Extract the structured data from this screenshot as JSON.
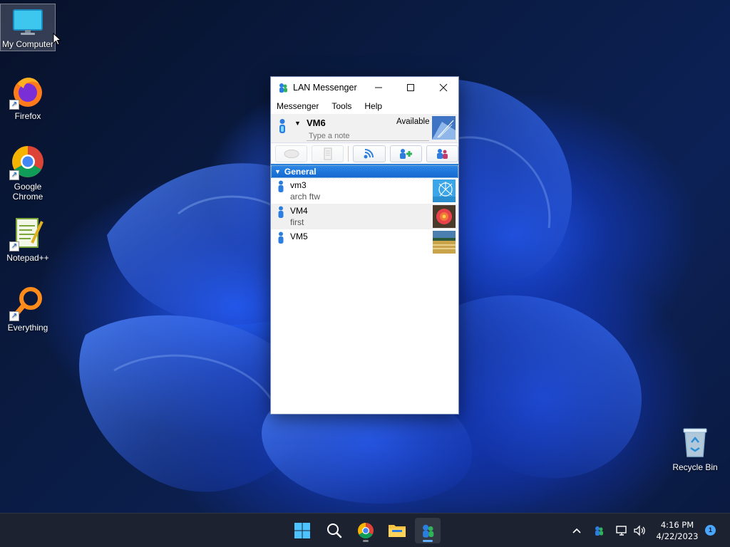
{
  "desktop": {
    "icons": [
      {
        "label": "My Computer",
        "icon": "monitor-icon"
      },
      {
        "label": "Firefox",
        "icon": "firefox-icon"
      },
      {
        "label": "Google Chrome",
        "icon": "chrome-icon"
      },
      {
        "label": "Notepad++",
        "icon": "notepadpp-icon"
      },
      {
        "label": "Everything",
        "icon": "magnifier-icon"
      },
      {
        "label": "Recycle Bin",
        "icon": "recycle-bin-icon"
      }
    ]
  },
  "window": {
    "title": "LAN Messenger",
    "menu": [
      "Messenger",
      "Tools",
      "Help"
    ],
    "user": {
      "name": "VM6",
      "status": "Available",
      "note_placeholder": "Type a note"
    },
    "group": "General",
    "contacts": [
      {
        "name": "vm3",
        "note": "arch ftw"
      },
      {
        "name": "VM4",
        "note": "first"
      },
      {
        "name": "VM5",
        "note": ""
      }
    ]
  },
  "taskbar": {
    "time": "4:16 PM",
    "date": "4/22/2023",
    "notifications": "1"
  },
  "colors": {
    "accent": "#1669cf",
    "taskbar": "#1c2230"
  }
}
